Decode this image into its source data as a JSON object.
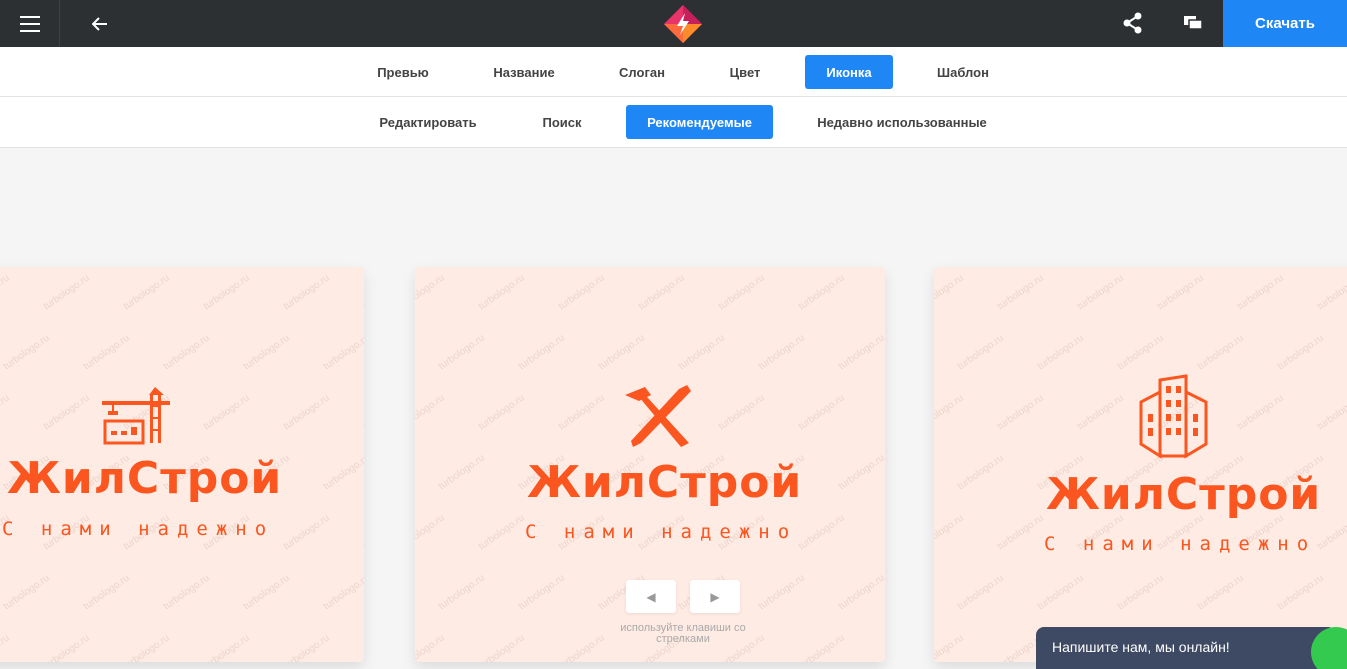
{
  "header": {
    "menu_icon": "hamburger-icon",
    "back_icon": "arrow-left-icon",
    "logo_icon": "turbologo-icon",
    "share_icon": "share-icon",
    "chat_icon": "chat-bubbles-icon",
    "download_label": "Скачать"
  },
  "tabs": [
    {
      "label": "Превью",
      "active": false
    },
    {
      "label": "Название",
      "active": false
    },
    {
      "label": "Слоган",
      "active": false
    },
    {
      "label": "Цвет",
      "active": false
    },
    {
      "label": "Иконка",
      "active": true
    },
    {
      "label": "Шаблон",
      "active": false
    }
  ],
  "subtabs": [
    {
      "label": "Редактировать",
      "active": false
    },
    {
      "label": "Поиск",
      "active": false
    },
    {
      "label": "Рекомендуемые",
      "active": true
    },
    {
      "label": "Недавно использованные",
      "active": false
    }
  ],
  "cards": [
    {
      "icon": "crane-building-icon",
      "name": "ЖилСтрой",
      "slogan": "С нами надежно"
    },
    {
      "icon": "hammer-saw-icon",
      "name": "ЖилСтрой",
      "slogan": "С нами надежно"
    },
    {
      "icon": "skyscraper-icon",
      "name": "ЖилСтрой",
      "slogan": "С нами надежно"
    }
  ],
  "watermark": "turbologo.ru",
  "navigation": {
    "prev_icon": "triangle-left-icon",
    "next_icon": "triangle-right-icon",
    "hint": "используйте клавиши со стрелками"
  },
  "chat_widget": {
    "label": "Напишите нам, мы онлайн!"
  },
  "colors": {
    "accent": "#1f86f5",
    "topbar": "#2d3033",
    "brand_orange": "#fb5620",
    "card_bg": "#feebe3"
  }
}
